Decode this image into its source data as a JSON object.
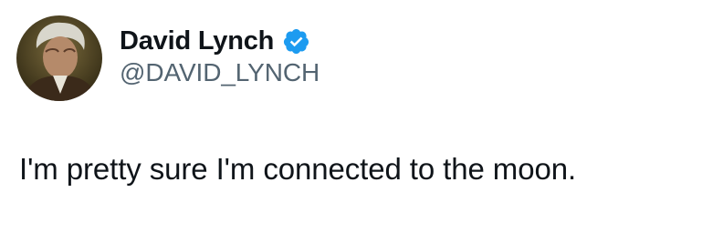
{
  "author": {
    "display_name": "David Lynch",
    "handle": "@DAVID_LYNCH",
    "verified": true,
    "avatar_icon": "profile-photo",
    "verified_icon": "verified-badge-icon"
  },
  "tweet": {
    "text": "I'm pretty sure I'm connected to the moon."
  },
  "colors": {
    "text_primary": "#0f1419",
    "text_secondary": "#536471",
    "verified_blue": "#1d9bf0",
    "background": "#ffffff"
  }
}
